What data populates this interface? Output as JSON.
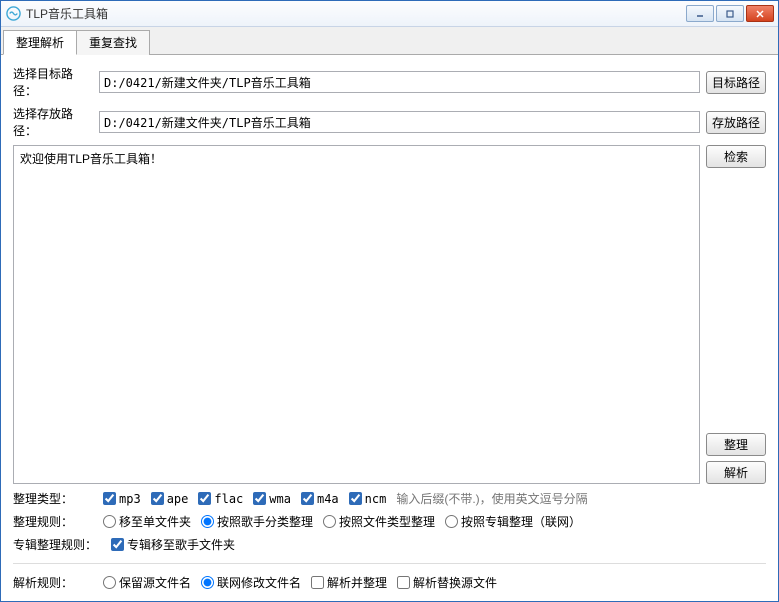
{
  "window": {
    "title": "TLP音乐工具箱"
  },
  "tabs": {
    "items": [
      {
        "label": "整理解析",
        "active": true
      },
      {
        "label": "重复查找",
        "active": false
      }
    ]
  },
  "paths": {
    "target_label": "选择目标路径：",
    "target_value": "D:/0421/新建文件夹/TLP音乐工具箱",
    "target_btn": "目标路径",
    "save_label": "选择存放路径：",
    "save_value": "D:/0421/新建文件夹/TLP音乐工具箱",
    "save_btn": "存放路径"
  },
  "log": {
    "text": "欢迎使用TLP音乐工具箱！"
  },
  "buttons": {
    "search": "检索",
    "organize": "整理",
    "parse": "解析"
  },
  "type_filter": {
    "label": "整理类型：",
    "items": [
      {
        "label": "mp3",
        "checked": true
      },
      {
        "label": "ape",
        "checked": true
      },
      {
        "label": "flac",
        "checked": true
      },
      {
        "label": "wma",
        "checked": true
      },
      {
        "label": "m4a",
        "checked": true
      },
      {
        "label": "ncm",
        "checked": true
      }
    ],
    "hint": "输入后缀(不带.)，使用英文逗号分隔"
  },
  "organize_rule": {
    "label": "整理规则：",
    "items": [
      {
        "label": "移至单文件夹",
        "checked": false
      },
      {
        "label": "按照歌手分类整理",
        "checked": true
      },
      {
        "label": "按照文件类型整理",
        "checked": false
      },
      {
        "label": "按照专辑整理（联网）",
        "checked": false
      }
    ]
  },
  "album_rule": {
    "label": "专辑整理规则：",
    "items": [
      {
        "label": "专辑移至歌手文件夹",
        "checked": true
      }
    ]
  },
  "parse_rule": {
    "label": "解析规则：",
    "radios": [
      {
        "label": "保留源文件名",
        "checked": false
      },
      {
        "label": "联网修改文件名",
        "checked": true
      }
    ],
    "checks": [
      {
        "label": "解析并整理",
        "checked": false
      },
      {
        "label": "解析替换源文件",
        "checked": false
      }
    ]
  }
}
